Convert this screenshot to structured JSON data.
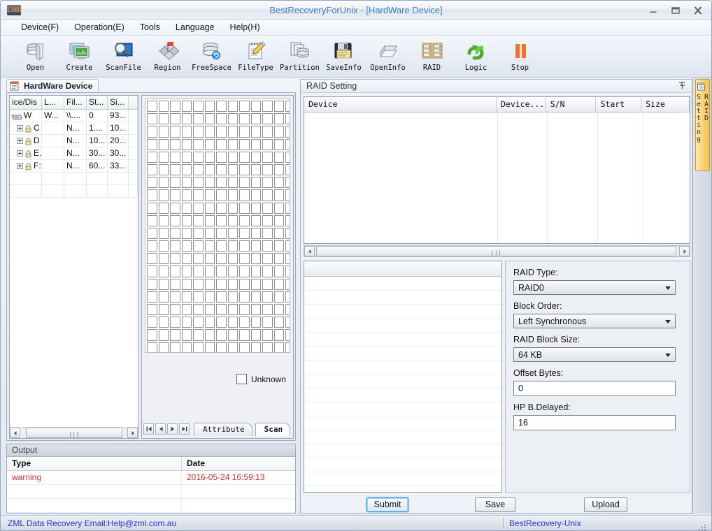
{
  "window": {
    "logo_text": "LMD",
    "title": "BestRecoveryForUnix - [HardWare Device]",
    "minimize_icon": "minimize-icon",
    "maximize_icon": "maximize-icon",
    "close_icon": "close-icon"
  },
  "menubar": {
    "items": [
      {
        "label": "Device(F)"
      },
      {
        "label": "Operation(E)"
      },
      {
        "label": "Tools"
      },
      {
        "label": "Language"
      },
      {
        "label": "Help(H)"
      }
    ]
  },
  "toolbar": {
    "buttons": [
      {
        "label": "Open",
        "icon": "open-disk-icon"
      },
      {
        "label": "Create",
        "icon": "create-monitor-icon"
      },
      {
        "label": "ScanFile",
        "icon": "scanfile-magnifier-icon"
      },
      {
        "label": "Region",
        "icon": "region-flag-icon"
      },
      {
        "label": "FreeSpace",
        "icon": "freespace-disk-refresh-icon"
      },
      {
        "label": "FileType",
        "icon": "filetype-notepad-pencil-icon"
      },
      {
        "label": "Partition",
        "icon": "partition-disk-doc-icon"
      },
      {
        "label": "SaveInfo",
        "icon": "saveinfo-floppy-icon"
      },
      {
        "label": "OpenInfo",
        "icon": "openinfo-disk-icon"
      },
      {
        "label": "RAID",
        "icon": "raid-servers-icon"
      },
      {
        "label": "Logic",
        "icon": "logic-link-icon"
      },
      {
        "label": "Stop",
        "icon": "stop-pause-icon"
      }
    ]
  },
  "left_dock": {
    "tab_label": "HardWare Device",
    "tab_icon": "document-icon",
    "device_table": {
      "columns": [
        "ice/Dis",
        "L...",
        "Fil...",
        "St...",
        "Si...",
        ""
      ],
      "rows": [
        {
          "indent": 0,
          "expander": false,
          "icon": "disk-icon",
          "name": "W",
          "cells": [
            "W...",
            "\\\\....",
            "0",
            "93...",
            ""
          ]
        },
        {
          "indent": 1,
          "expander": true,
          "icon": "lock-icon",
          "name": "C",
          "cells": [
            "",
            "N...",
            "1....",
            "10...",
            ""
          ]
        },
        {
          "indent": 1,
          "expander": true,
          "icon": "lock-icon",
          "name": "D",
          "cells": [
            "",
            "N...",
            "10...",
            "20...",
            ""
          ]
        },
        {
          "indent": 1,
          "expander": true,
          "icon": "lock-icon",
          "name": "E.",
          "cells": [
            "",
            "N...",
            "30...",
            "30...",
            ""
          ]
        },
        {
          "indent": 1,
          "expander": true,
          "icon": "lock-icon",
          "name": "F:",
          "cells": [
            "",
            "N...",
            "60...",
            "33...",
            ""
          ]
        }
      ]
    },
    "map": {
      "columns": 14,
      "rows": 22,
      "legend_label": "Unknown",
      "legend_color": "#ffffff"
    },
    "nav": {
      "first_icon": "first-record-icon",
      "prev_icon": "prev-record-icon",
      "next_icon": "next-record-icon",
      "last_icon": "last-record-icon",
      "tabs": [
        {
          "label": "Attribute",
          "active": false
        },
        {
          "label": "Scan",
          "active": true
        }
      ]
    }
  },
  "output_dock": {
    "title": "Output",
    "columns": [
      "Type",
      "Date"
    ],
    "rows": [
      {
        "type": "warning",
        "date": "2016-05-24 16:59:13"
      },
      {
        "type": "",
        "date": ""
      },
      {
        "type": "",
        "date": ""
      }
    ],
    "row_color": "#c0392b"
  },
  "raid_dock": {
    "title": "RAID Setting",
    "pin_icon": "pin-icon",
    "table": {
      "columns": [
        "Device",
        "Device...",
        "S/N",
        "Start",
        "Size"
      ],
      "rows": []
    },
    "member_list": {
      "rows": 16
    },
    "form": {
      "fields": [
        {
          "label": "RAID Type:",
          "type": "combo",
          "value": "RAID0"
        },
        {
          "label": "Block Order:",
          "type": "combo",
          "value": "Left Synchronous"
        },
        {
          "label": "RAID Block Size:",
          "type": "combo",
          "value": "64 KB"
        },
        {
          "label": "Offset Bytes:",
          "type": "input",
          "value": "0"
        },
        {
          "label": "HP B.Delayed:",
          "type": "input",
          "value": "16"
        }
      ]
    },
    "buttons": [
      {
        "label": "Submit",
        "focused": true
      },
      {
        "label": "Save",
        "focused": false
      },
      {
        "label": "Upload",
        "focused": false
      }
    ]
  },
  "side_tab": {
    "label": "RAID Setting",
    "icon": "raid-setting-icon",
    "color": "#f3c557"
  },
  "statusbar": {
    "left_text": "ZML Data Recovery Email:Help@zml.com.au",
    "right_text": "BestRecovery-Unix",
    "text_color": "#2a32d6"
  }
}
